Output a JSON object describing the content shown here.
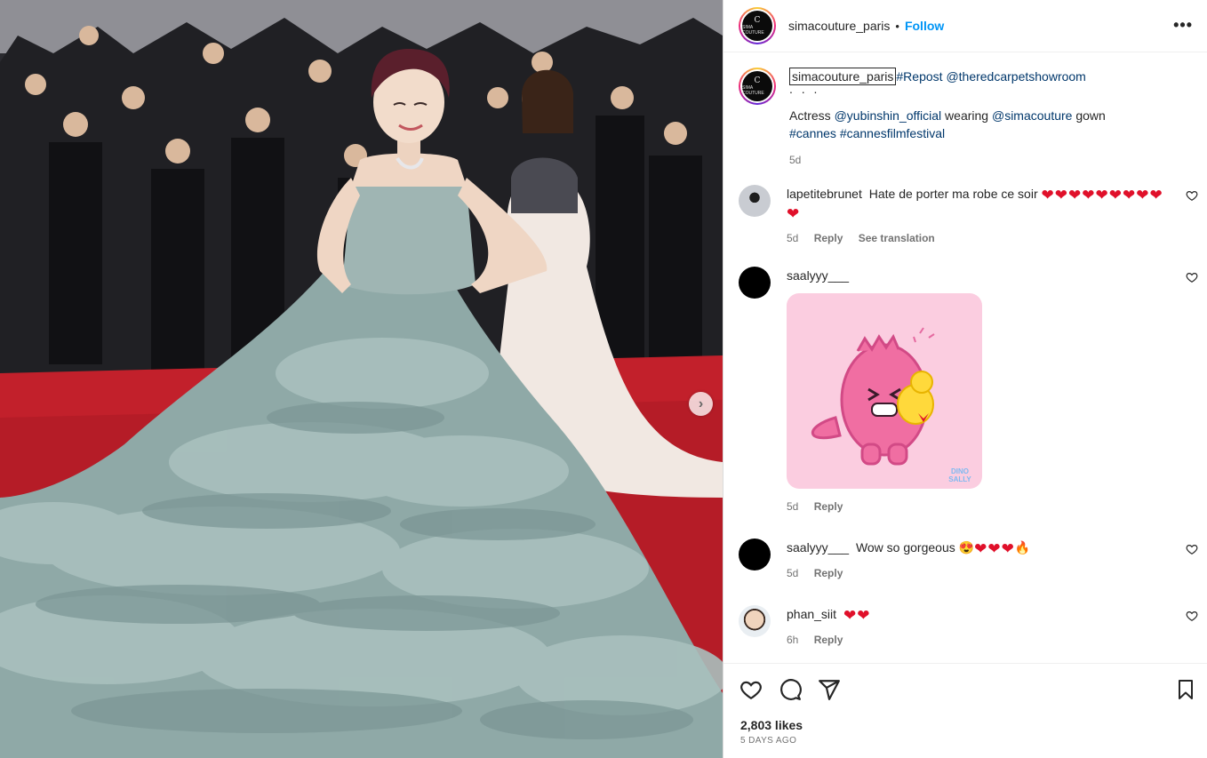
{
  "post": {
    "username": "simacouture_paris",
    "follow_label": "Follow",
    "separator": "•",
    "more_label": "•••",
    "avatar_monogram": "C",
    "avatar_text": "SIMA COUTURE",
    "next_label": "›"
  },
  "caption": {
    "username": "simacouture_paris",
    "hashtag_repost": "#Repost",
    "mention_source": "@theredcarpetshowroom",
    "dots": ". . .",
    "line_prefix": "Actress ",
    "mention_actress": "@yubinshin_official",
    "line_middle": " wearing ",
    "mention_brand": "@simacouture",
    "line_suffix": " gown",
    "hashtags": "#cannes #cannesfilmfestival",
    "time_ago": "5d"
  },
  "comments": [
    {
      "user": "lapetitebrunet",
      "text": "Hate de porter ma robe ce soir",
      "hearts": 10,
      "time": "5d",
      "reply": "Reply",
      "see_translation": "See translation",
      "avatar_color": "#c9ccd2"
    },
    {
      "user": "saalyyy___",
      "text": "",
      "sticker_brand": "DINO SALLY",
      "time": "5d",
      "reply": "Reply",
      "avatar_color": "#000000"
    },
    {
      "user": "saalyyy___",
      "text": "Wow so gorgeous",
      "emojis": "😍",
      "hearts": 3,
      "emoji_end": "🔥",
      "time": "5d",
      "reply": "Reply",
      "avatar_color": "#000000"
    },
    {
      "user": "phan_siit",
      "text": "",
      "hearts": 2,
      "time": "6h",
      "reply": "Reply",
      "avatar_color": "#d8c6b2"
    }
  ],
  "actions": {
    "likes": "2,803 likes",
    "date": "5 DAYS AGO"
  },
  "icons": [
    "heart-icon",
    "comment-icon",
    "share-icon",
    "bookmark-icon",
    "more-options-icon",
    "chevron-right-icon"
  ],
  "colors": {
    "link": "#00376b",
    "follow": "#0095f6",
    "heart": "#e0102a",
    "meta": "#737373",
    "sticker_bg": "#fbcde0",
    "dino": "#f06ea2"
  }
}
